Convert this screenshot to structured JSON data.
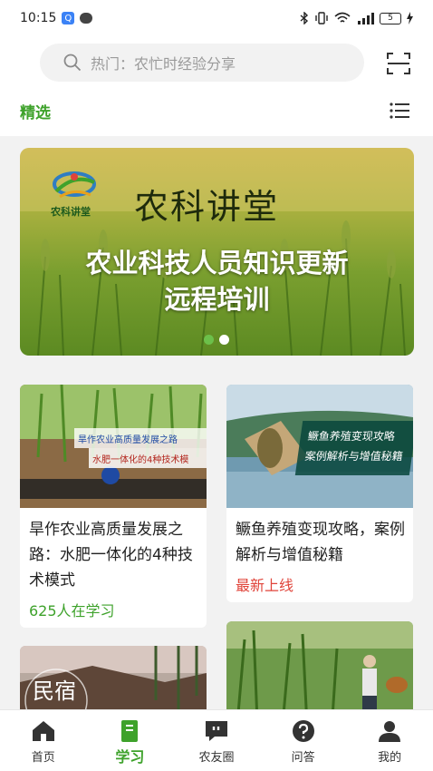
{
  "status_bar": {
    "time": "10:15",
    "badge": "Q",
    "battery": "5"
  },
  "search": {
    "placeholder": "热门：农忙时经验分享"
  },
  "tabs": {
    "featured": "精选"
  },
  "banner": {
    "brand_title": "农科讲堂",
    "logo_text": "农科讲堂",
    "headline_line1": "农业科技人员知识更新",
    "headline_line2": "远程培训"
  },
  "cards": [
    {
      "title": "旱作农业高质量发展之路：水肥一体化的4种技术模式",
      "thumb_caption_top": "旱作农业高质量发展之路",
      "thumb_caption_bottom": "水肥一体化的4种技术模",
      "meta": "625人在学习"
    },
    {
      "title": "鳜鱼养殖变现攻略，案例解析与增值秘籍",
      "thumb_caption": "鳜鱼养殖变现攻略 案例解析与增值秘籍",
      "meta": "最新上线"
    },
    {
      "thumb_caption": "民宿"
    },
    {
      "thumb_caption": ""
    }
  ],
  "bottom_nav": {
    "items": [
      "首页",
      "学习",
      "农友圈",
      "问答",
      "我的"
    ],
    "active": "学习"
  },
  "colors": {
    "accent": "#3ea22b",
    "new_tag": "#e0443a"
  }
}
